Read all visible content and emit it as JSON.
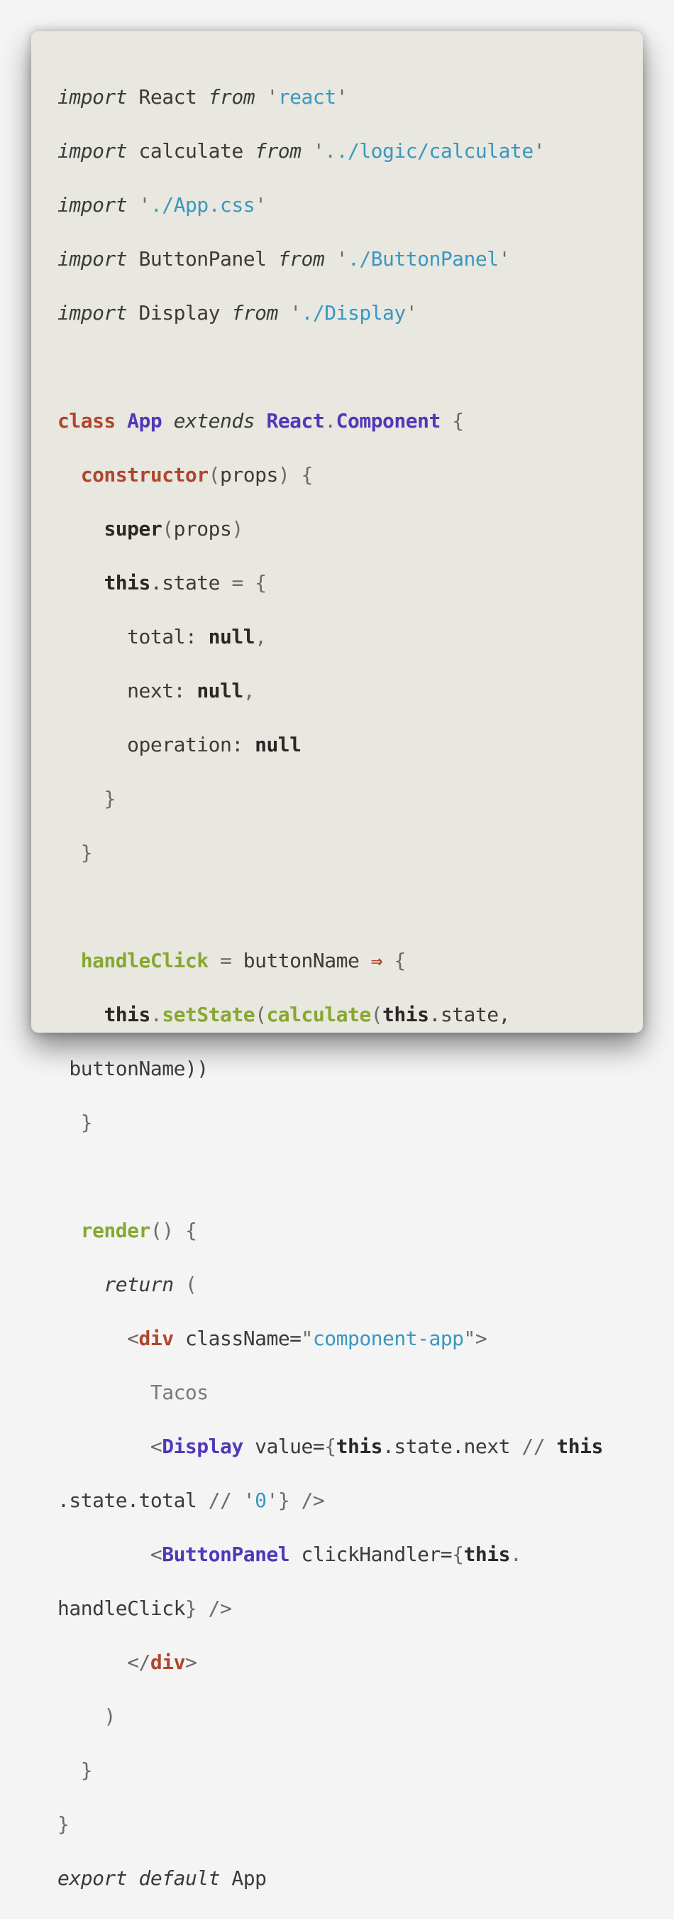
{
  "code": {
    "imports": [
      {
        "kw": "import",
        "name": "React",
        "from": "from",
        "path": "react"
      },
      {
        "kw": "import",
        "name": "calculate",
        "from": "from",
        "path": "../logic/calculate"
      },
      {
        "kw": "import",
        "name": "",
        "from": "",
        "path": "./App.css"
      },
      {
        "kw": "import",
        "name": "ButtonPanel",
        "from": "from",
        "path": "./ButtonPanel"
      },
      {
        "kw": "import",
        "name": "Display",
        "from": "from",
        "path": "./Display"
      }
    ],
    "class_kw": "class",
    "class_name": "App",
    "extends_kw": "extends",
    "base_obj": "React",
    "base_cls": "Component",
    "constructor_kw": "constructor",
    "props": "props",
    "super_kw": "super",
    "this_kw": "this",
    "state_prop": ".state",
    "state_fields": [
      {
        "key": "total:",
        "value": "null",
        "sep": ","
      },
      {
        "key": "next:",
        "value": "null",
        "sep": ","
      },
      {
        "key": "operation:",
        "value": "null",
        "sep": ""
      }
    ],
    "handler_name": "handleClick",
    "param": "buttonName",
    "arrow": "⇒",
    "set_state": "setState",
    "calculate": "calculate",
    "state_arg": ".state,",
    "param_wrapped": "buttonName))",
    "render_fn": "render",
    "return_kw": "return",
    "div_tag": "div",
    "class_attr": "className=",
    "class_value": "component-app",
    "text_node": "Tacos",
    "display_tag": "Display",
    "value_attr": "value=",
    "state_next": ".state.next",
    "or_op": "//",
    "state_total": ".state.total",
    "zero_str": "0",
    "panel_tag": "ButtonPanel",
    "click_attr": "clickHandler=",
    "handle_click_ref": "handleClick",
    "export_kw": "export",
    "default_kw": "default",
    "export_name": "App"
  }
}
